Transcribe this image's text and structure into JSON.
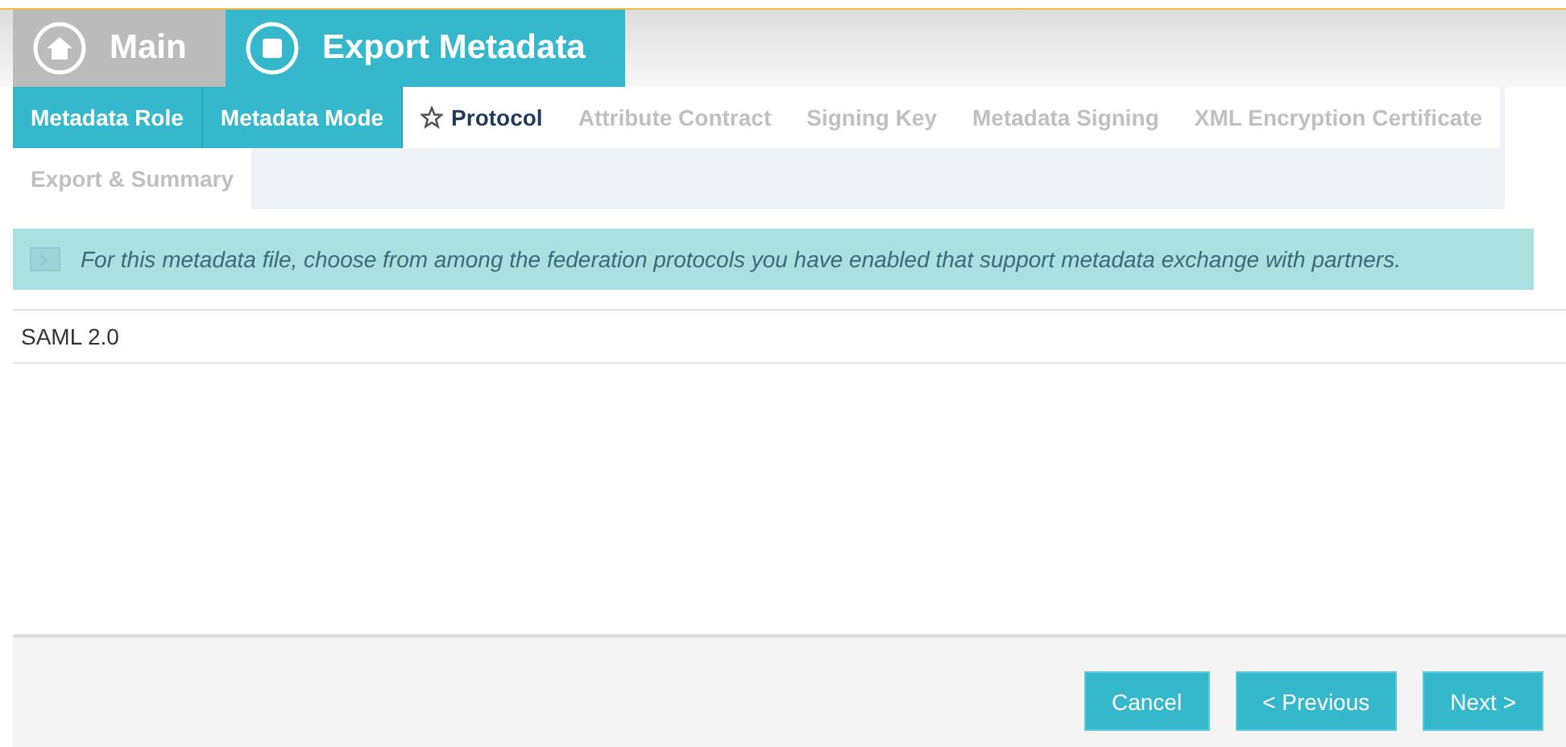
{
  "header_tabs": [
    {
      "label": "Main",
      "selected": false
    },
    {
      "label": "Export Metadata",
      "selected": true
    }
  ],
  "steps": [
    {
      "label": "Metadata Role",
      "done": true,
      "selected": false
    },
    {
      "label": "Metadata Mode",
      "done": true,
      "selected": false
    },
    {
      "label": "Protocol",
      "done": false,
      "selected": true
    },
    {
      "label": "Attribute Contract",
      "done": false,
      "selected": false
    },
    {
      "label": "Signing Key",
      "done": false,
      "selected": false
    },
    {
      "label": "Metadata Signing",
      "done": false,
      "selected": false
    },
    {
      "label": "XML Encryption Certificate",
      "done": false,
      "selected": false
    },
    {
      "label": "Export & Summary",
      "done": false,
      "selected": false
    }
  ],
  "info": "For this metadata file, choose from among the federation protocols you have enabled that support metadata exchange with partners.",
  "protocols": [
    "SAML 2.0"
  ],
  "buttons": [
    {
      "label": "Cancel"
    },
    {
      "label": "< Previous"
    },
    {
      "label": "Next >"
    }
  ]
}
